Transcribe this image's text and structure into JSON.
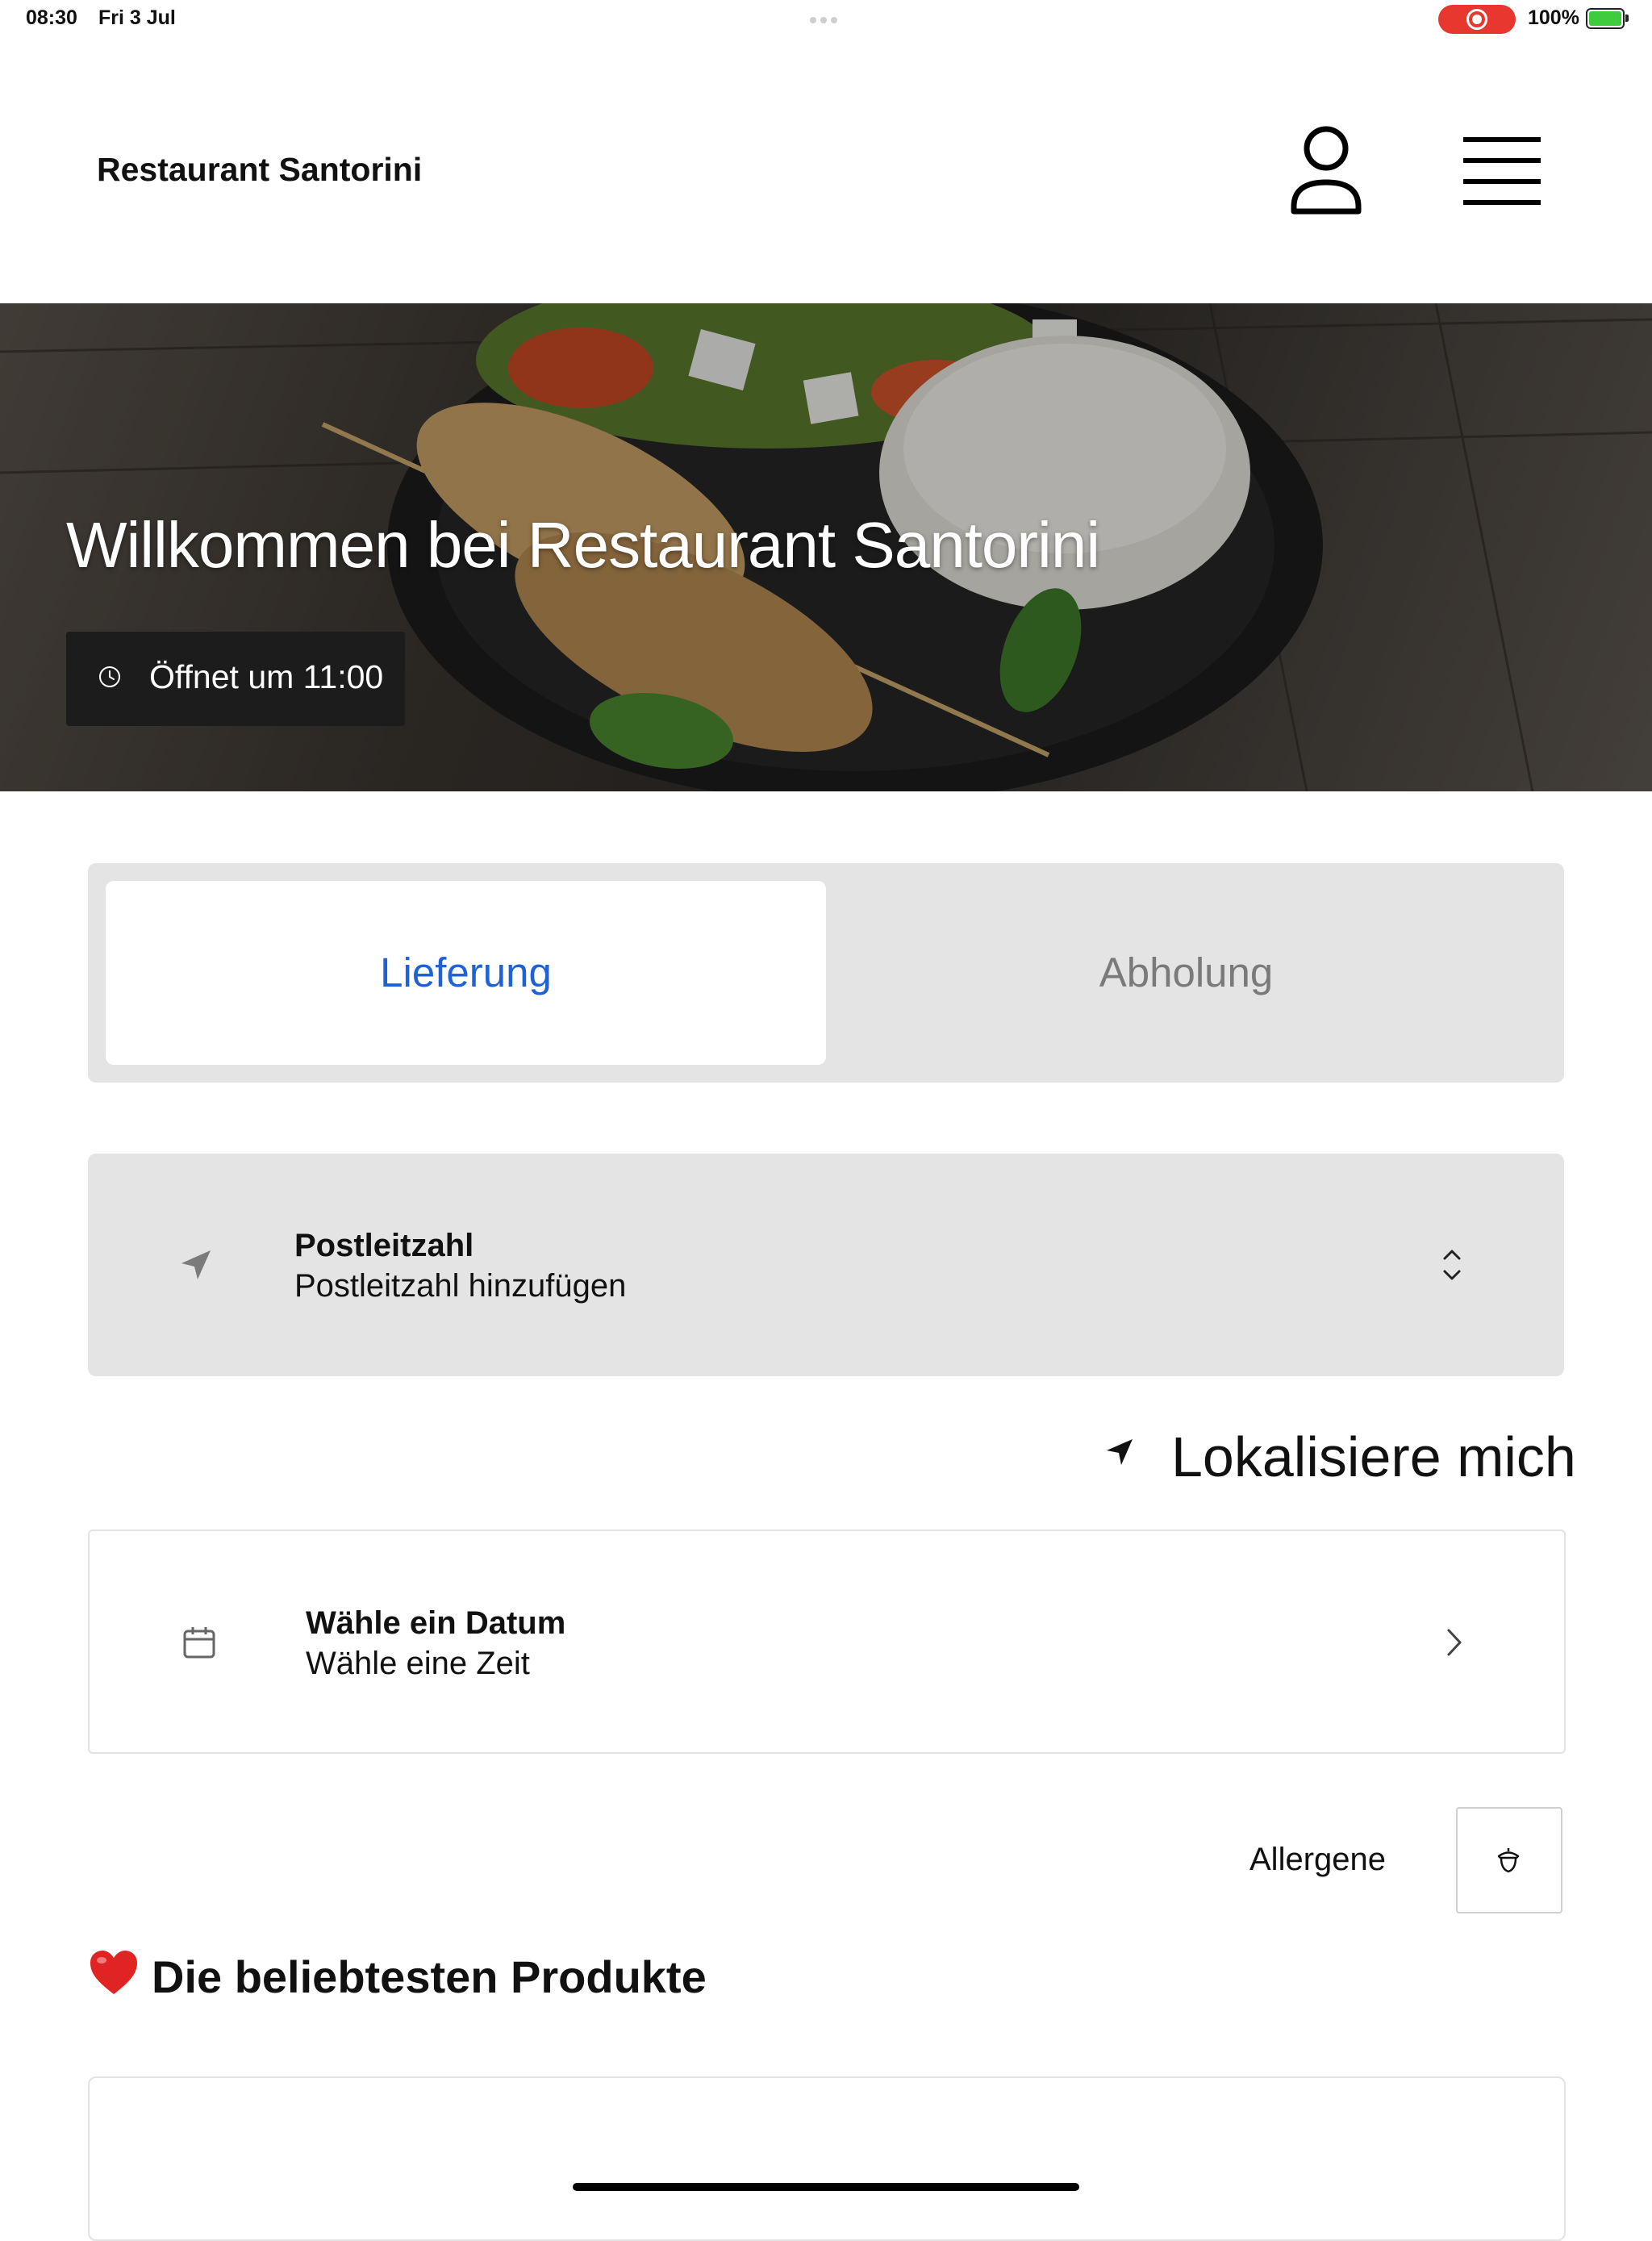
{
  "status_bar": {
    "time": "08:30",
    "date": "Fri 3 Jul",
    "battery": "100%"
  },
  "header": {
    "brand": "Restaurant Santorini"
  },
  "hero": {
    "title": "Willkommen bei Restaurant Santorini",
    "open_status": "Öffnet um 11:00"
  },
  "order_mode": {
    "options": [
      "Lieferung",
      "Abholung"
    ],
    "selected": "Lieferung"
  },
  "postcode": {
    "label": "Postleitzahl",
    "placeholder": "Postleitzahl hinzufügen"
  },
  "locate": {
    "label": "Lokalisiere mich"
  },
  "schedule": {
    "date_label": "Wähle ein Datum",
    "time_label": "Wähle eine Zeit"
  },
  "allergens": {
    "label": "Allergene"
  },
  "popular": {
    "title": "Die beliebtesten Produkte"
  },
  "colors": {
    "accent": "#1f62d6",
    "tab_inactive": "#7a7a7a",
    "panel_bg": "#e4e4e4",
    "recording": "#e8372f"
  }
}
